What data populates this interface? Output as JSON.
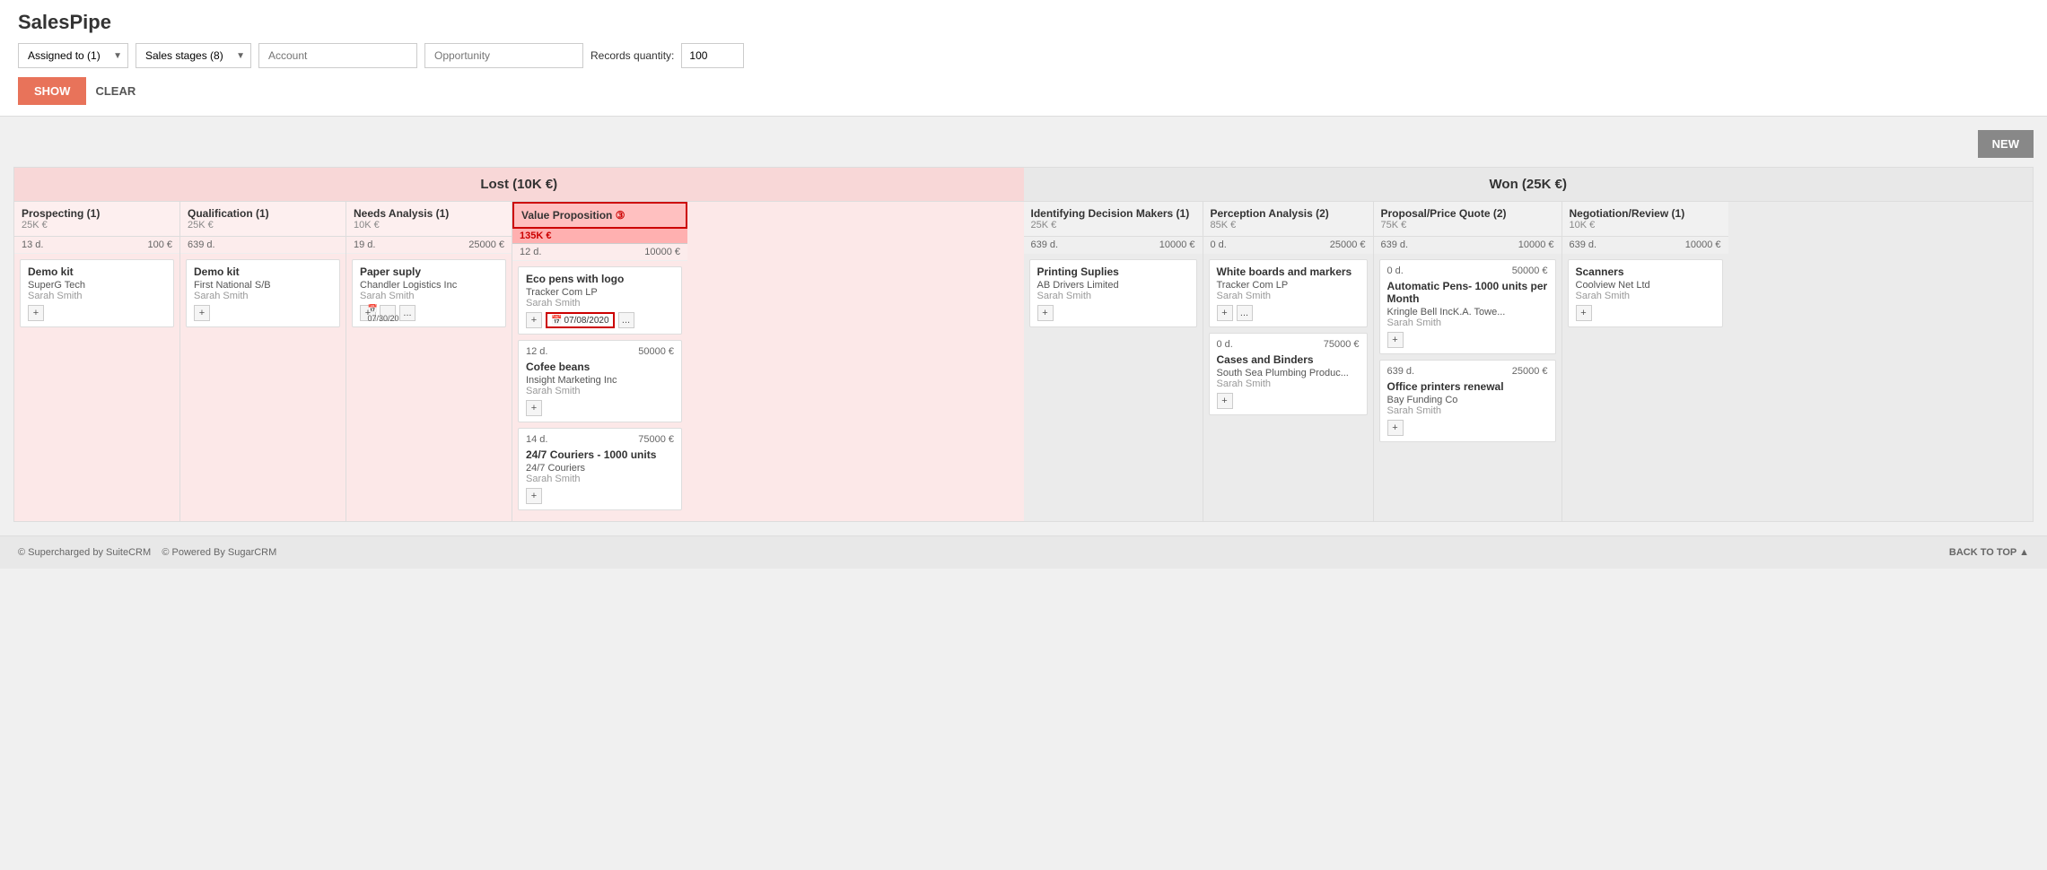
{
  "app": {
    "title": "SalesPipe"
  },
  "filters": {
    "assigned_to_label": "Assigned to (1)",
    "sales_stages_label": "Sales stages (8)",
    "account_placeholder": "Account",
    "opportunity_placeholder": "Opportunity",
    "records_label": "Records quantity:",
    "records_value": "100"
  },
  "buttons": {
    "show": "SHOW",
    "clear": "CLEAR",
    "new": "NEW"
  },
  "sections": {
    "lost": {
      "label": "Lost (10K €)"
    },
    "won": {
      "label": "Won (25K €)"
    }
  },
  "columns": [
    {
      "id": "prospecting",
      "title": "Prospecting (1)",
      "subtitle": "25K €",
      "days": "13 d.",
      "amount": "100 €",
      "section": "lost",
      "cards": [
        {
          "title": "Demo kit",
          "company": "SuperG Tech",
          "user": "Sarah Smith",
          "has_add": true
        }
      ]
    },
    {
      "id": "qualification",
      "title": "Qualification (1)",
      "subtitle": "25K €",
      "days": "639 d.",
      "amount": "",
      "section": "lost",
      "cards": [
        {
          "title": "Demo kit",
          "company": "First National S/B",
          "user": "Sarah Smith",
          "has_add": true
        }
      ]
    },
    {
      "id": "needs-analysis",
      "title": "Needs Analysis (1)",
      "subtitle": "10K €",
      "days": "19 d.",
      "amount": "25000 €",
      "section": "lost",
      "cards": [
        {
          "title": "Paper suply",
          "company": "Chandler Logistics Inc",
          "user": "Sarah Smith",
          "date": "07/30/2020",
          "has_add": true,
          "has_menu": true
        }
      ]
    },
    {
      "id": "value-proposition",
      "title": "Value Proposition",
      "count": 3,
      "subtitle": "135K €",
      "days": "12 d.",
      "amount": "10000 €",
      "section": "lost",
      "highlighted": true,
      "cards": [
        {
          "title": "Eco pens with logo",
          "company": "Tracker Com LP",
          "user": "Sarah Smith",
          "date_highlight": "07/08/2020",
          "has_add": true,
          "has_menu": true
        },
        {
          "title": "Cofee beans",
          "company": "Insight Marketing Inc",
          "user": "Sarah Smith",
          "days": "12 d.",
          "amount": "50000 €",
          "has_add": true
        },
        {
          "title": "24/7 Couriers - 1000 units",
          "company": "24/7 Couriers",
          "user": "Sarah Smith",
          "days": "14 d.",
          "amount": "75000 €",
          "has_add": true
        }
      ]
    },
    {
      "id": "identifying-decision-makers",
      "title": "Identifying Decision Makers (1)",
      "subtitle": "25K €",
      "days": "639 d.",
      "amount": "10000 €",
      "section": "won",
      "cards": [
        {
          "title": "Printing Suplies",
          "company": "AB Drivers Limited",
          "user": "Sarah Smith",
          "has_add": true
        }
      ]
    },
    {
      "id": "perception-analysis",
      "title": "Perception Analysis (2)",
      "subtitle": "85K €",
      "days": "0 d.",
      "amount": "25000 €",
      "section": "won",
      "cards": [
        {
          "title": "White boards and markers",
          "company": "Tracker Com LP",
          "user": "Sarah Smith",
          "has_add": true,
          "has_menu": true
        },
        {
          "title": "Cases and Binders",
          "company": "South Sea Plumbing Produc...",
          "user": "Sarah Smith",
          "days": "0 d.",
          "amount": "75000 €",
          "has_add": true
        }
      ]
    },
    {
      "id": "proposal-price-quote",
      "title": "Proposal/Price Quote (2)",
      "subtitle": "75K €",
      "days": "639 d.",
      "amount": "10000 €",
      "section": "won",
      "cards": [
        {
          "title": "Automatic Pens- 1000 units per Month",
          "company": "Kringle Bell IncK.A. Towe...",
          "user": "Sarah Smith",
          "days": "0 d.",
          "amount": "50000 €",
          "has_add": true
        },
        {
          "title": "Office printers renewal",
          "company": "Bay Funding Co",
          "user": "Sarah Smith",
          "days": "639 d.",
          "amount": "25000 €",
          "has_add": true
        }
      ]
    },
    {
      "id": "negotiation-review",
      "title": "Negotiation/Review (1)",
      "subtitle": "10K €",
      "days": "639 d.",
      "amount": "10000 €",
      "section": "won",
      "cards": [
        {
          "title": "Scanners",
          "company": "Coolview Net Ltd",
          "user": "Sarah Smith",
          "has_add": true
        }
      ]
    }
  ],
  "footer": {
    "left1": "© Supercharged by SuiteCRM",
    "left2": "© Powered By SugarCRM",
    "back_to_top": "BACK TO TOP ▲"
  }
}
